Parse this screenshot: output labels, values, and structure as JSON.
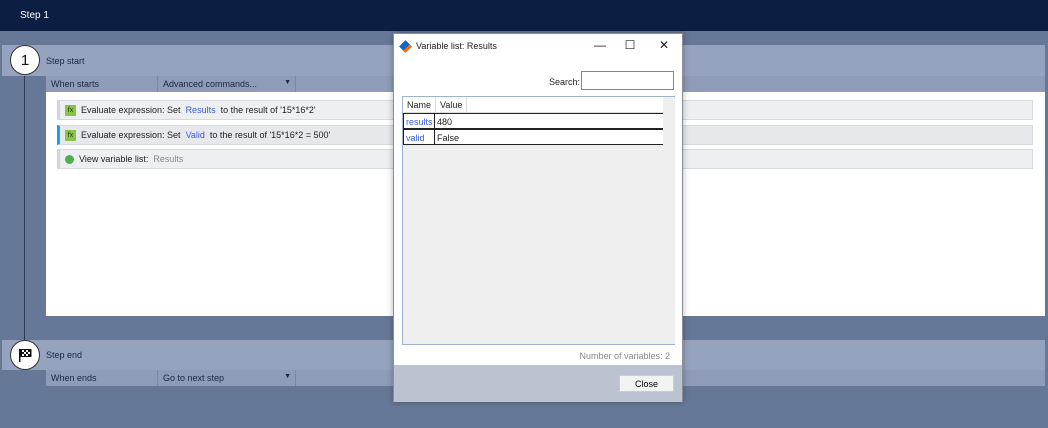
{
  "window_title": "Step 1",
  "step_start": {
    "number": "1",
    "title": "Step start",
    "trigger_label": "When starts",
    "command_select": "Advanced commands..."
  },
  "commands": [
    {
      "prefix": "Evaluate expression: Set",
      "variable": "Results",
      "suffix": "to the result of '15*16*2'"
    },
    {
      "prefix": "Evaluate expression: Set",
      "variable": "Valid",
      "suffix": "to the result of '15*16*2 = 500'"
    },
    {
      "prefix": "View variable list:",
      "variable": "Results"
    }
  ],
  "step_end": {
    "title": "Step end",
    "trigger_label": "When ends",
    "action_select": "Go to next step"
  },
  "dialog": {
    "title": "Variable list: Results",
    "search_label": "Search:",
    "search_value": "",
    "columns": [
      "Name",
      "Value"
    ],
    "rows": [
      {
        "name": "results",
        "value": "480"
      },
      {
        "name": "valid",
        "value": "False"
      }
    ],
    "count_text": "Number of variables: 2",
    "close_label": "Close"
  }
}
